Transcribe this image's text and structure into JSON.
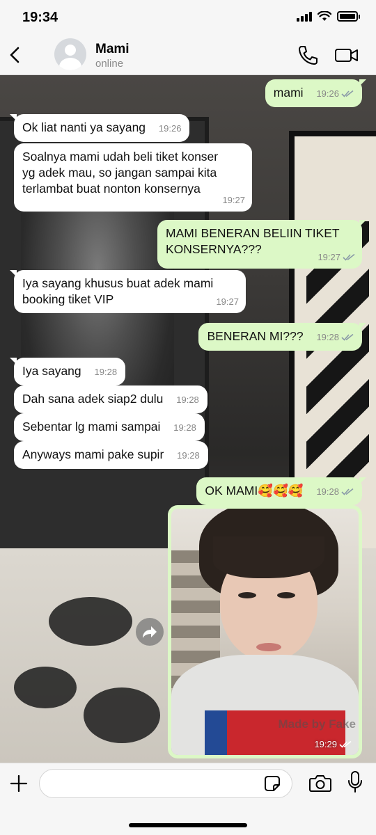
{
  "status_bar": {
    "time": "19:34"
  },
  "header": {
    "contact_name": "Mami",
    "contact_status": "online"
  },
  "messages": [
    {
      "dir": "out",
      "text": "mami",
      "time": "19:26"
    },
    {
      "dir": "in",
      "text": "Ok liat nanti ya sayang",
      "time": "19:26"
    },
    {
      "dir": "in",
      "text": "Soalnya mami udah beli tiket konser\nyg adek mau, so jangan sampai kita\nterlambat buat nonton konsernya",
      "time": "19:27"
    },
    {
      "dir": "out",
      "text": "MAMI BENERAN BELIIN TIKET\nKONSERNYA???",
      "time": "19:27"
    },
    {
      "dir": "in",
      "text": "Iya sayang khusus buat adek mami\nbooking tiket VIP",
      "time": "19:27"
    },
    {
      "dir": "out",
      "text": "BENERAN MI???",
      "time": "19:28"
    },
    {
      "dir": "in",
      "text": "Iya sayang",
      "time": "19:28"
    },
    {
      "dir": "in",
      "text": "Dah sana adek siap2 dulu",
      "time": "19:28"
    },
    {
      "dir": "in",
      "text": "Sebentar lg mami sampai",
      "time": "19:28"
    },
    {
      "dir": "in",
      "text": "Anyways mami pake supir",
      "time": "19:28"
    },
    {
      "dir": "out",
      "text": "OK MAMI🥰🥰🥰",
      "time": "19:28"
    }
  ],
  "photo_message": {
    "time": "19:29",
    "watermark": "Made by Fake"
  },
  "colors": {
    "outgoing_bubble": "#dcf8c6",
    "incoming_bubble": "#ffffff",
    "read_ticks": "#8a9aa8"
  },
  "icons": [
    "back-icon",
    "video-call-icon",
    "phone-icon",
    "plus-icon",
    "sticker-icon",
    "camera-icon",
    "mic-icon",
    "forward-icon",
    "double-check-icon"
  ]
}
